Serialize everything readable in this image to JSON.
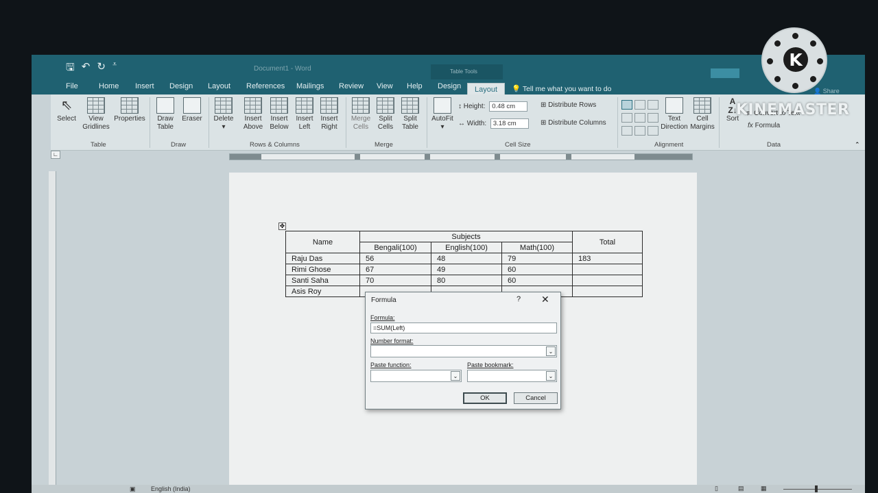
{
  "app": {
    "doc_title": "Document1 - Word",
    "tools_label": "Table Tools",
    "qat_icons": [
      "save-icon",
      "undo-icon",
      "redo-icon",
      "customize-icon"
    ]
  },
  "tabs": {
    "file": "File",
    "home": "Home",
    "insert": "Insert",
    "design": "Design",
    "layout": "Layout",
    "references": "References",
    "mailings": "Mailings",
    "review": "Review",
    "view": "View",
    "help": "Help",
    "table_design": "Design",
    "table_layout": "Layout",
    "tell_me": "Tell me what you want to do",
    "share": "Share"
  },
  "ribbon": {
    "select": "Select",
    "view_gridlines": [
      "View",
      "Gridlines"
    ],
    "properties": "Properties",
    "table_group": "Table",
    "draw_table": [
      "Draw",
      "Table"
    ],
    "eraser": "Eraser",
    "draw_group": "Draw",
    "delete": "Delete",
    "insert_above": [
      "Insert",
      "Above"
    ],
    "insert_below": [
      "Insert",
      "Below"
    ],
    "insert_left": [
      "Insert",
      "Left"
    ],
    "insert_right": [
      "Insert",
      "Right"
    ],
    "rows_columns_group": "Rows & Columns",
    "merge_cells": [
      "Merge",
      "Cells"
    ],
    "split_cells": [
      "Split",
      "Cells"
    ],
    "split_table": [
      "Split",
      "Table"
    ],
    "merge_group": "Merge",
    "autofit": "AutoFit",
    "height_label": "Height:",
    "height_value": "0.48 cm",
    "width_label": "Width:",
    "width_value": "3.18 cm",
    "distribute_rows": "Distribute Rows",
    "distribute_columns": "Distribute Columns",
    "cell_size_group": "Cell Size",
    "text_direction": [
      "Text",
      "Direction"
    ],
    "cell_margins": [
      "Cell",
      "Margins"
    ],
    "alignment_group": "Alignment",
    "sort": "Sort",
    "convert_to_text": "Convert to Text",
    "formula": "Formula",
    "data_group": "Data"
  },
  "table": {
    "header": {
      "name": "Name",
      "subjects": "Subjects",
      "total": "Total"
    },
    "subheaders": [
      "Bengali(100)",
      "English(100)",
      "Math(100)"
    ],
    "rows": [
      {
        "name": "Raju Das",
        "bengali": "56",
        "english": "48",
        "math": "79",
        "total": "183"
      },
      {
        "name": "Rimi Ghose",
        "bengali": "67",
        "english": "49",
        "math": "60",
        "total": ""
      },
      {
        "name": "Santi Saha",
        "bengali": "70",
        "english": "80",
        "math": "60",
        "total": ""
      },
      {
        "name": "Asis Roy",
        "bengali": "",
        "english": "",
        "math": "",
        "total": ""
      }
    ]
  },
  "dialog": {
    "title": "Formula",
    "help": "?",
    "close": "✕",
    "formula_label": "Formula:",
    "formula_value": "=SUM(Left)",
    "number_format_label": "Number format:",
    "paste_function_label": "Paste function:",
    "paste_bookmark_label": "Paste bookmark:",
    "ok": "OK",
    "cancel": "Cancel"
  },
  "status": {
    "language": "English (India)"
  },
  "watermark": {
    "brand": "KINEMASTER",
    "logo_letter": "K"
  }
}
